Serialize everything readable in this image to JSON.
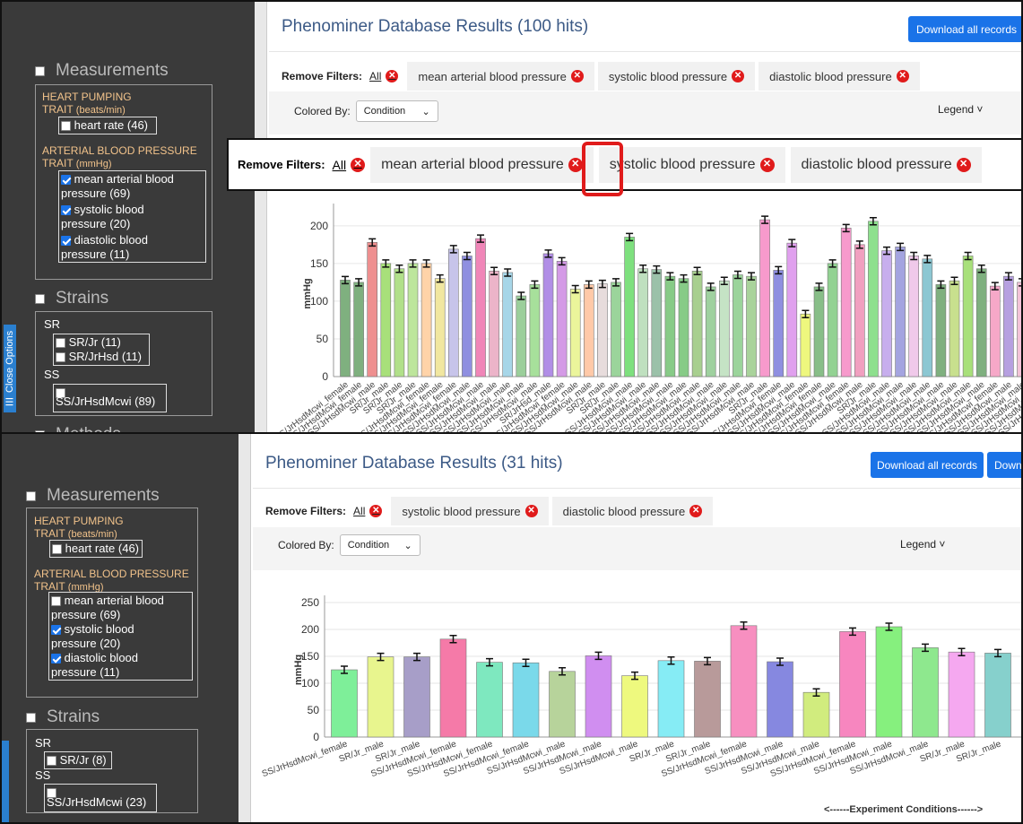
{
  "top": {
    "sidebar": {
      "close_tab": "☰ Close Options",
      "measurements": "Measurements",
      "heart_group": "HEART PUMPING",
      "heart_group2": "TRAIT",
      "heart_unit": "(beats/min)",
      "heart_rate": "heart rate (46)",
      "art_group": "ARTERIAL BLOOD PRESSURE",
      "art_group2": "TRAIT",
      "art_unit": "(mmHg)",
      "map1": "mean arterial blood",
      "map2": "pressure (69)",
      "sbp1": "systolic blood",
      "sbp2": "pressure (20)",
      "dbp1": "diastolic blood",
      "dbp2": "pressure (11)",
      "strains": "Strains",
      "sr": "SR",
      "srjr": "SR/Jr (11)",
      "srjrhsd": "SR/JrHsd (11)",
      "ss": "SS",
      "ssjr": "SS/JrHsdMcwi (89)",
      "methods": "Methods"
    },
    "title": "Phenominer Database Results (100 hits)",
    "download": "Download all records",
    "remove_filters": "Remove Filters:",
    "all": "All",
    "filters": [
      "mean arterial blood pressure",
      "systolic blood pressure",
      "diastolic blood pressure"
    ],
    "colored_by": "Colored By:",
    "condition": "Condition",
    "legend": "Legend"
  },
  "bottom": {
    "sidebar": {
      "measurements": "Measurements",
      "heart_group": "HEART PUMPING",
      "heart_group2": "TRAIT",
      "heart_unit": "(beats/min)",
      "heart_rate": "heart rate (46)",
      "art_group": "ARTERIAL BLOOD PRESSURE",
      "art_group2": "TRAIT",
      "art_unit": "(mmHg)",
      "map1": "mean arterial blood",
      "map2": "pressure (69)",
      "sbp1": "systolic blood",
      "sbp2": "pressure (20)",
      "dbp1": "diastolic blood",
      "dbp2": "pressure (11)",
      "strains": "Strains",
      "sr": "SR",
      "srjr": "SR/Jr (8)",
      "ss": "SS",
      "ssjr": "SS/JrHsdMcwi (23)"
    },
    "title": "Phenominer Database Results (31 hits)",
    "download": "Download all records",
    "download2": "Down",
    "remove_filters": "Remove Filters:",
    "all": "All",
    "filters": [
      "systolic blood pressure",
      "diastolic blood pressure"
    ],
    "colored_by": "Colored By:",
    "condition": "Condition",
    "legend": "Legend",
    "x_caption": "<------Experiment Conditions------>"
  },
  "zoom": {
    "remove_filters": "Remove Filters:",
    "all": "All",
    "filters": [
      "mean arterial blood pressure",
      "systolic blood pressure",
      "diastolic blood pressure"
    ]
  },
  "chart_data": [
    {
      "type": "bar",
      "ylabel": "mmHg",
      "ylim": [
        0,
        220
      ],
      "yticks": [
        0,
        50,
        100,
        150,
        200
      ],
      "categories": [
        "SS/JrHsdMcwi_female",
        "SS/JrHsdMcwi_female",
        "SS/JrHsdMcwi_male",
        "SR/Jr_male",
        "SR/Jr_male",
        "SR/Jr_male",
        "SS/JrHsdMcwi_female",
        "SS/JrHsdMcwi_female",
        "SS/JrHsdMcwi_female",
        "SS/JrHsdMcwi_male",
        "SS/JrHsdMcwi_male",
        "SS/JrHsdMcwi_male",
        "SS/JrHsdMcwi_male",
        "SS/JrHsdMcwi_male",
        "SS/JrHsdMcwi_male",
        "SR/JrHsd_male",
        "SS/JrHsdMcwi_female",
        "SS/JrHsdMcwi_male",
        "SS/JrHsdMcwi_male",
        "SR/Jr_male",
        "SR/Jr_male",
        "SS/JrHsdMcwi_male",
        "SS/JrHsdMcwi_male",
        "SS/JrHsdMcwi_male",
        "SS/JrHsdMcwi_male",
        "SS/JrHsdMcwi_male",
        "SS/JrHsdMcwi_male",
        "SS/JrHsdMcwi_male",
        "SS/JrHsdMcwi_male",
        "SS/JrHsdMcwi_male",
        "SS/JrHsdMcwi_male",
        "SR/Jr_male",
        "SS/JrHsdMcwi_female",
        "SS/JrHsdMcwi_male",
        "SS/JrHsdMcwi_female",
        "SS/JrHsdMcwi_female",
        "SS/JrHsdMcwi_male",
        "SS/JrHsdMcwi_female",
        "SS/JrHsdMcwi_male",
        "SR/Jr_male",
        "SS/JrHsdMcwi_male",
        "SS/JrHsdMcwi_male",
        "SS/JrHsdMcwi_male",
        "SS/JrHsdMcwi_male",
        "SS/JrHsdMcwi_male",
        "SS/JrHsdMcwi_male",
        "SS/JrHsdMcwi_male",
        "SS/JrHsdMcwi_male",
        "SS/JrHsdMcwi_female",
        "SS/JrHsdMcwi_male",
        "SS/JrHsdMcwi_male",
        "SS/JrHsdMcwi_male",
        "SS/JrHsdMcwi_male",
        "SS/JrHsdMcwi_male"
      ],
      "values": [
        128,
        125,
        178,
        150,
        143,
        150,
        150,
        130,
        169,
        160,
        183,
        140,
        138,
        107,
        122,
        163,
        153,
        116,
        122,
        123,
        125,
        185,
        143,
        142,
        133,
        130,
        140,
        119,
        127,
        135,
        133,
        208,
        141,
        177,
        83,
        119,
        150,
        197,
        175,
        206,
        167,
        172,
        160,
        156,
        122,
        127,
        160,
        143,
        120,
        133,
        125,
        147,
        160,
        135,
        160,
        160
      ],
      "colors": [
        "#7fb07f",
        "#7fb07f",
        "#ee8f8f",
        "#a8e07a",
        "#b1e08a",
        "#bde69c",
        "#ffd3a8",
        "#f1e7a0",
        "#c7c4ea",
        "#8f8fe0",
        "#f086b8",
        "#ecb4c9",
        "#a7d6e8",
        "#9bcf9b",
        "#a7e09b",
        "#b18ee6",
        "#d49ae6",
        "#ebf59b",
        "#ffc9a8",
        "#e7dcdc",
        "#9bd49b",
        "#7ee07e",
        "#bfe0bf",
        "#9bc1a9",
        "#87cb87",
        "#87cb87",
        "#a8cf8f",
        "#9fd19f",
        "#c5e3c5",
        "#9bd49b",
        "#a9d39b",
        "#f79acc",
        "#8f8fe0",
        "#e0a0ee",
        "#eef77e",
        "#88be88",
        "#93d293",
        "#f79acc",
        "#f1a0c0",
        "#8ee08e",
        "#c7aeed",
        "#a4a4e0",
        "#f0c9ea",
        "#8cc7d2",
        "#7fb07f",
        "#c8e08e",
        "#a8e07a",
        "#7fb07f",
        "#f6a8c8",
        "#b6a0e0",
        "#f3c3d8",
        "#f6a8c8",
        "#f6a8c8",
        "#a99090",
        "#c6ebc6",
        "#c6ebc6"
      ]
    },
    {
      "type": "bar",
      "ylabel": "mmHg",
      "ylim": [
        0,
        250
      ],
      "yticks": [
        0,
        50,
        100,
        150,
        200,
        250
      ],
      "xlabel": "<------Experiment Conditions------>",
      "categories": [
        "SS/JrHsdMcwi_female",
        "SR/Jr_male",
        "SR/Jr_male",
        "SS/JrHsdMcwi_female",
        "SS/JrHsdMcwi_female",
        "SS/JrHsdMcwi_female",
        "SS/JrHsdMcwi_male",
        "SS/JrHsdMcwi_male",
        "SS/JrHsdMcwi_male",
        "SR/Jr_male",
        "SR/Jr_male",
        "SS/JrHsdMcwi_female",
        "SS/JrHsdMcwi_male",
        "SS/JrHsdMcwi_male",
        "SS/JrHsdMcwi_female",
        "SS/JrHsdMcwi_male",
        "SS/JrHsdMcwi_male",
        "SR/Jr_male",
        "SR/Jr_male"
      ],
      "values": [
        125,
        149,
        149,
        182,
        139,
        138,
        122,
        151,
        114,
        142,
        141,
        207,
        140,
        83,
        196,
        205,
        166,
        158,
        156
      ],
      "colors": [
        "#7eef99",
        "#e8f58e",
        "#a79ec8",
        "#f57aa8",
        "#7ee8bf",
        "#7ad9ea",
        "#b7d39b",
        "#d08ef0",
        "#eef97e",
        "#86ecf5",
        "#b89a9a",
        "#f78fc0",
        "#8688e0",
        "#d1ec7e",
        "#f786bf",
        "#86f07e",
        "#8ee88e",
        "#f5a8f0",
        "#86d0cc"
      ]
    }
  ]
}
